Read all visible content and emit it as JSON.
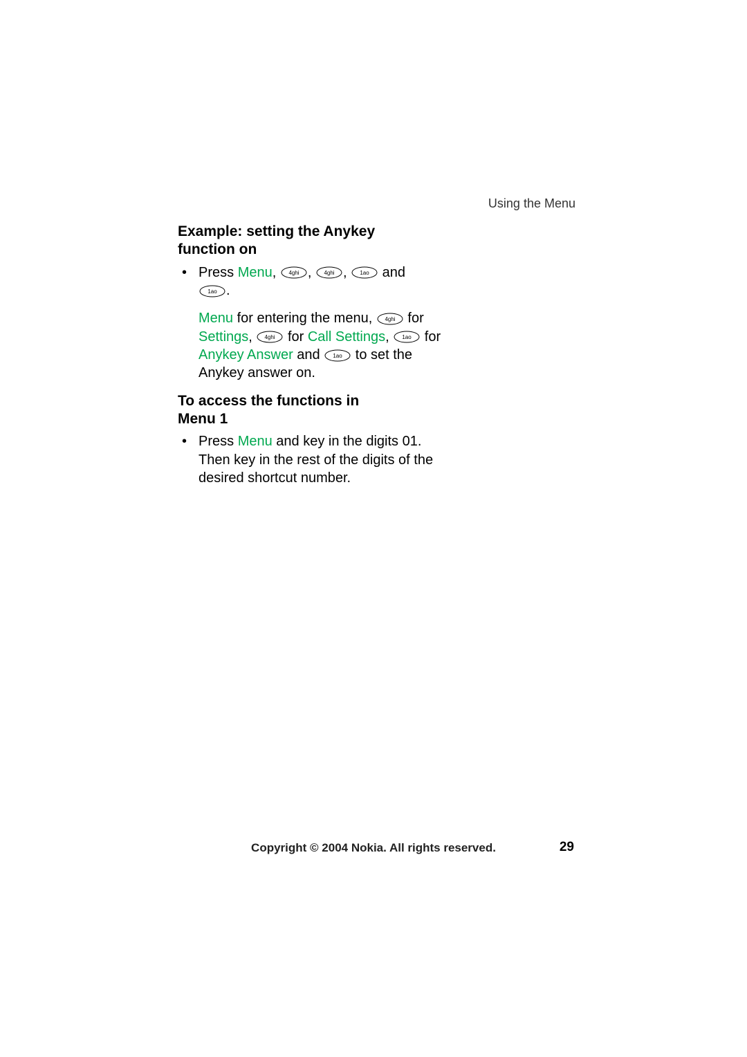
{
  "header": {
    "section": "Using the Menu"
  },
  "section1": {
    "heading_line1": "Example: setting the Anykey",
    "heading_line2": "function on",
    "bullet": {
      "press": "Press ",
      "menu": "Menu",
      "sep1": ", ",
      "sep2": ", ",
      "sep3": ", ",
      "and": " and",
      "period": "."
    },
    "explanation": {
      "menu": "Menu",
      "t1": " for entering the menu, ",
      "t2": "for ",
      "settings": "Settings",
      "t3": ",  ",
      "t4": " for ",
      "call_settings": "Call Settings",
      "t5": ", ",
      "t6": " for ",
      "anykey_answer": "Anykey Answer",
      "t7": " and ",
      "t8": "to set the Anykey answer on."
    }
  },
  "section2": {
    "heading_line1": "To access the functions in",
    "heading_line2": "Menu 1",
    "bullet": {
      "t1": "Press ",
      "menu": "Menu",
      "t2": " and key in the digits 01. Then key in the rest of the digits of the desired shortcut number."
    }
  },
  "keys": {
    "k4": "4ghi",
    "k1": "1ao"
  },
  "footer": {
    "copyright": "Copyright © 2004 Nokia. All rights reserved.",
    "page": "29"
  }
}
